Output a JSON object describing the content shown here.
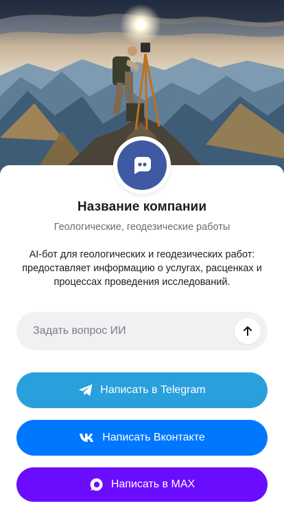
{
  "company": {
    "name": "Название компании",
    "category": "Геологические, геодезические работы",
    "description": "AI-бот для геологических и геодезических работ: предоставляет информацию о услугах, расценках и процессах проведения исследований."
  },
  "ask": {
    "placeholder": "Задать вопрос ИИ",
    "value": ""
  },
  "buttons": {
    "telegram": {
      "label": "Написать в Telegram",
      "color": "#29a0dc",
      "icon": "telegram-icon"
    },
    "vk": {
      "label": "Написать Вконтакте",
      "color": "#0077ff",
      "icon": "vk-icon"
    },
    "max": {
      "label": "Написать в MAX",
      "color": "#6a0dff",
      "icon": "max-icon"
    }
  },
  "colors": {
    "avatar_bg": "#3f5aa3",
    "field_bg": "#f1f1f3"
  }
}
